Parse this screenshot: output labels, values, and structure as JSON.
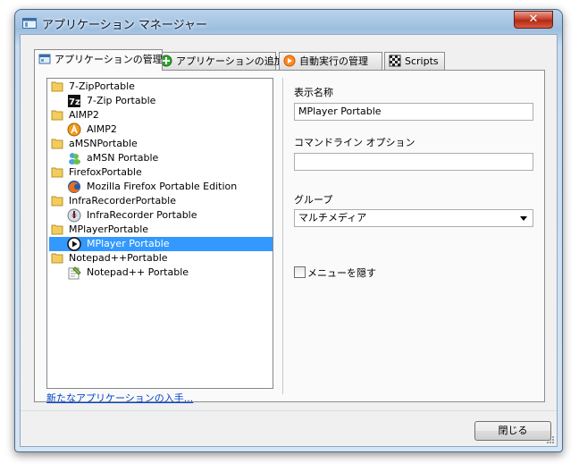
{
  "window": {
    "title": "アプリケーション マネージャー",
    "close_label": "✕"
  },
  "tabs": [
    {
      "label": "アプリケーションの管理",
      "icon": "manage-icon",
      "active": true
    },
    {
      "label": "アプリケーションの追加",
      "icon": "add-icon",
      "active": false
    },
    {
      "label": "自動実行の管理",
      "icon": "autorun-icon",
      "active": false
    },
    {
      "label": "Scripts",
      "icon": "checkered-flag-icon",
      "active": false
    }
  ],
  "tree": {
    "groups": [
      {
        "label": "7-ZipPortable",
        "child": "7-Zip Portable",
        "icon": "7zip-icon"
      },
      {
        "label": "AIMP2",
        "child": "AIMP2",
        "icon": "aimp-icon"
      },
      {
        "label": "aMSNPortable",
        "child": "aMSN Portable",
        "icon": "amsn-icon"
      },
      {
        "label": "FirefoxPortable",
        "child": "Mozilla Firefox Portable Edition",
        "icon": "firefox-icon"
      },
      {
        "label": "InfraRecorderPortable",
        "child": "InfraRecorder Portable",
        "icon": "infrarecorder-icon"
      },
      {
        "label": "MPlayerPortable",
        "child": "MPlayer Portable",
        "icon": "mplayer-icon",
        "selected": true
      },
      {
        "label": "Notepad++Portable",
        "child": "Notepad++ Portable",
        "icon": "notepad-icon"
      }
    ]
  },
  "get_apps_link": "新たなアプリケーションの入手...",
  "form": {
    "display_name_label": "表示名称",
    "display_name_value": "MPlayer Portable",
    "cmdline_label": "コマンドライン オプション",
    "cmdline_value": "",
    "group_label": "グループ",
    "group_value": "マルチメディア",
    "hide_menu_label": "メニューを隠す",
    "hide_menu_checked": false
  },
  "close_button_label": "閉じる",
  "colors": {
    "selection": "#3399ff",
    "link": "#0044cc",
    "titlebar": "#9dbedf"
  }
}
